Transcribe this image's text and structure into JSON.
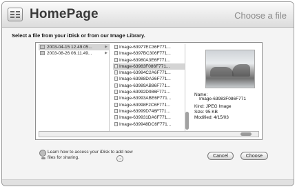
{
  "app": {
    "title": "HomePage",
    "step": "Choose a file"
  },
  "instruction": "Select a file from your iDisk or from our Image Library.",
  "browser": {
    "column1": [
      {
        "name": "2003-04-15 12.49.05...",
        "selected": true
      },
      {
        "name": "2003-08-26 06.11.49...",
        "selected": false
      }
    ],
    "column2": [
      {
        "name": "Image-63977EC36F771...",
        "selected": false
      },
      {
        "name": "Image-6397BC306F771...",
        "selected": false
      },
      {
        "name": "Image-63980A3E6F771...",
        "selected": false
      },
      {
        "name": "Image-63983F086F771...",
        "selected": true
      },
      {
        "name": "Image-63984C2A6F771...",
        "selected": false
      },
      {
        "name": "Image-63988DA36F771...",
        "selected": false
      },
      {
        "name": "Image-63989AB86F771...",
        "selected": false
      },
      {
        "name": "Image-63992D986F771...",
        "selected": false
      },
      {
        "name": "Image-63993ABE6F771...",
        "selected": false
      },
      {
        "name": "Image-63998F2C6F771...",
        "selected": false
      },
      {
        "name": "Image-63999D746F771...",
        "selected": false
      },
      {
        "name": "Image-639931DA6F771...",
        "selected": false
      },
      {
        "name": "Image-639948DC6F771...",
        "selected": false
      }
    ]
  },
  "preview": {
    "name_label": "Name:",
    "name_value": "Image-63983F086F771",
    "kind": "Kind: JPEG Image",
    "size": "Size: 95 KB",
    "modified": "Modified: 4/15/03"
  },
  "help": {
    "text": "Learn how to access your iDisk to add new files for sharing."
  },
  "buttons": {
    "cancel": "Cancel",
    "choose": "Choose"
  }
}
